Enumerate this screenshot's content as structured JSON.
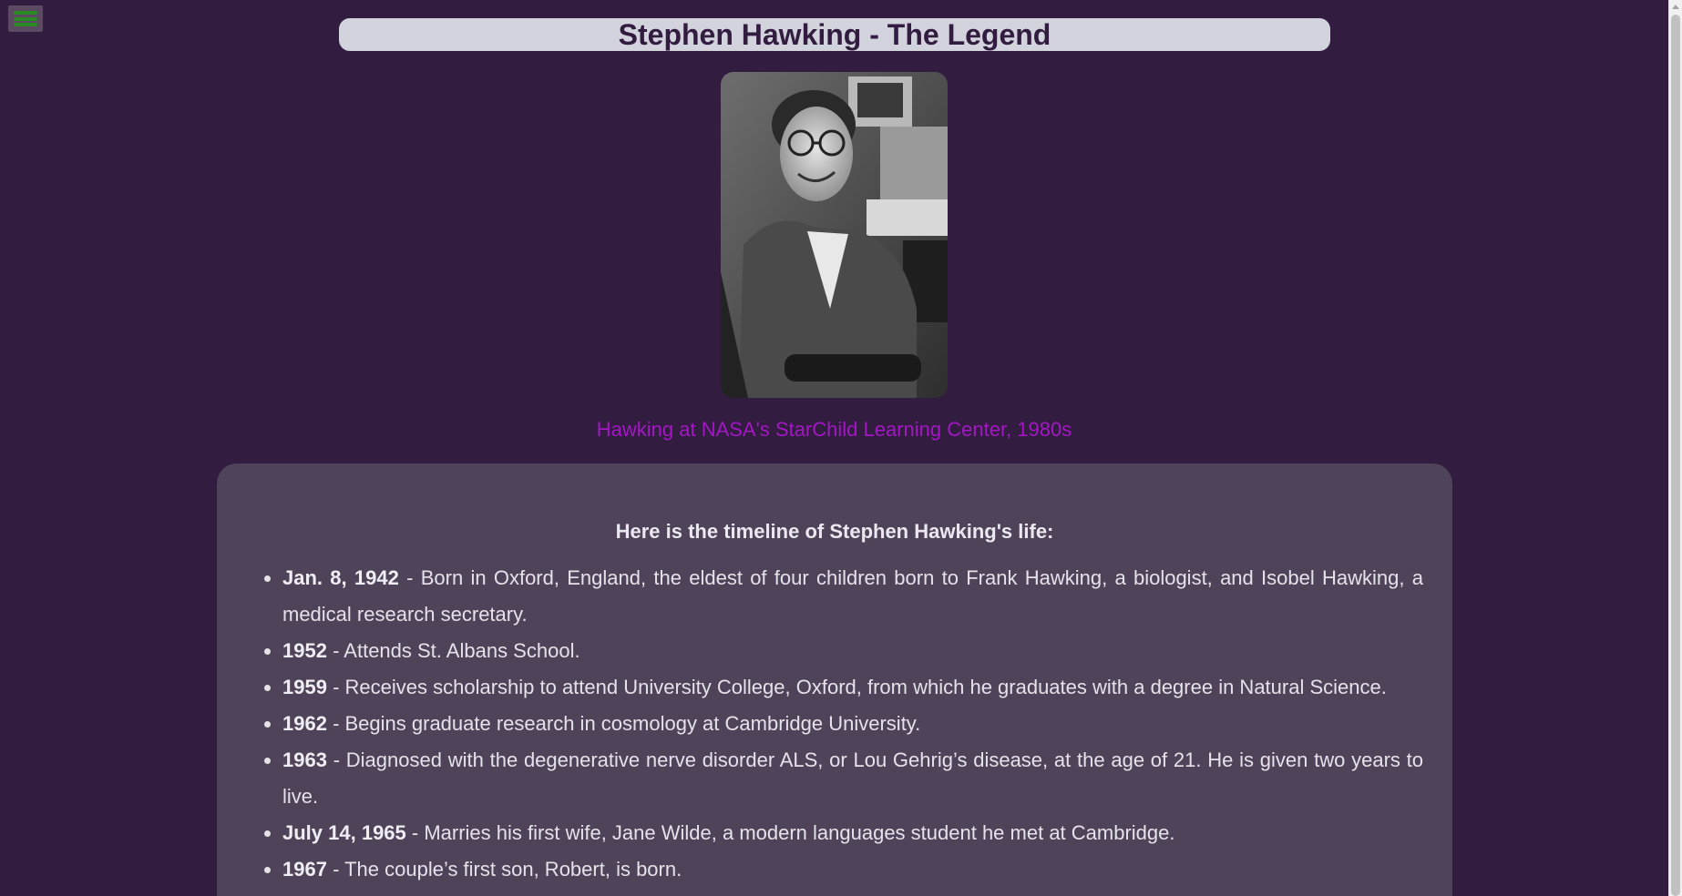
{
  "nav": {
    "menu_icon": "hamburger-menu-icon",
    "menu_color": "#2a8a24"
  },
  "header": {
    "title": "Stephen Hawking - The Legend"
  },
  "photo": {
    "description_icon": "portrait-photo"
  },
  "caption": {
    "text": "Hawking at NASA's StarChild Learning Center, 1980s",
    "color": "#a317c4"
  },
  "timeline": {
    "heading": "Here is the timeline of Stephen Hawking's life:",
    "entries": [
      {
        "date": "Jan. 8, 1942",
        "text": " - Born in Oxford, England, the eldest of four children born to Frank Hawking, a biologist, and Isobel Hawking, a medical research secretary."
      },
      {
        "date": "1952",
        "text": " - Attends St. Albans School."
      },
      {
        "date": "1959",
        "text": " - Receives scholarship to attend University College, Oxford, from which he graduates with a degree in Natural Science."
      },
      {
        "date": "1962",
        "text": " - Begins graduate research in cosmology at Cambridge University."
      },
      {
        "date": "1963",
        "text": " - Diagnosed with the degenerative nerve disorder ALS, or Lou Gehrig’s disease, at the age of 21. He is given two years to live."
      },
      {
        "date": "July 14, 1965",
        "text": " - Marries his first wife, Jane Wilde, a modern languages student he met at Cambridge."
      },
      {
        "date": "1967",
        "text": " - The couple’s first son, Robert, is born."
      }
    ]
  },
  "colors": {
    "background": "#321c40",
    "card": "#4f435a",
    "title_bar": "#d3d3dd"
  }
}
